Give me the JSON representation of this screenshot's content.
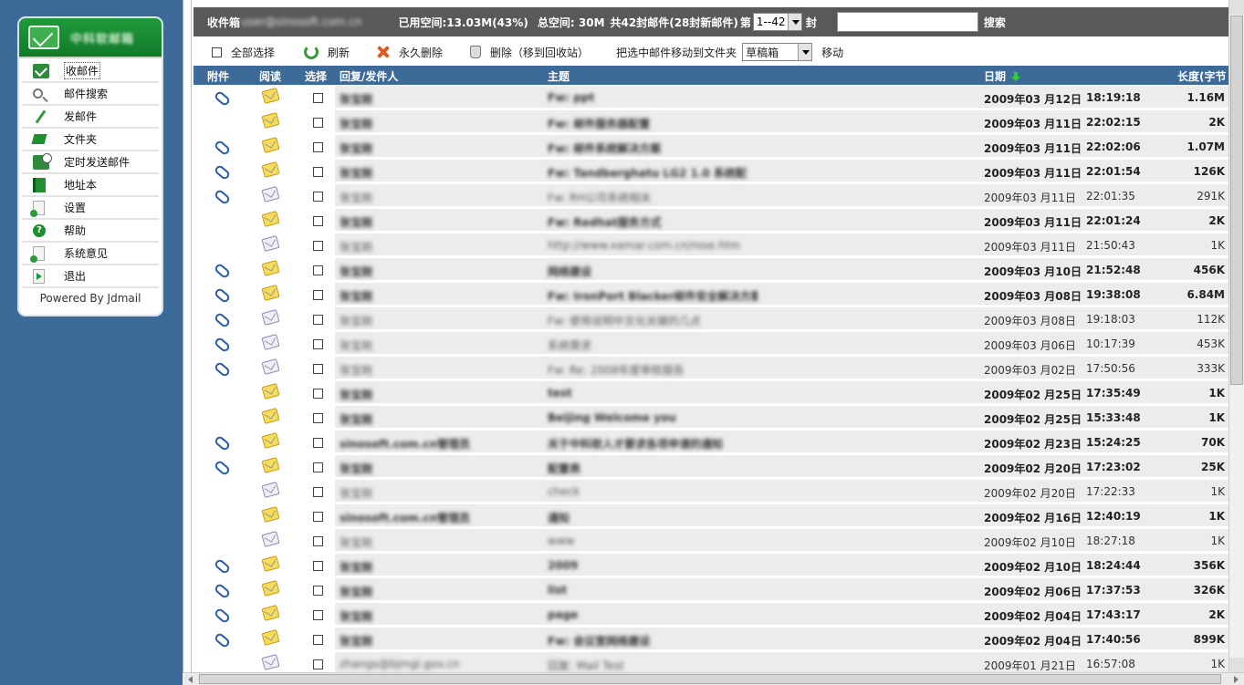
{
  "sidebar": {
    "logo_text": "中科软邮箱",
    "items": [
      {
        "label": "收邮件",
        "icon": "inbox-icon"
      },
      {
        "label": "邮件搜索",
        "icon": "search-icon"
      },
      {
        "label": "发邮件",
        "icon": "pen-icon"
      },
      {
        "label": "文件夹",
        "icon": "folder-icon"
      },
      {
        "label": "定时发送邮件",
        "icon": "timer-mail-icon"
      },
      {
        "label": "地址本",
        "icon": "address-book-icon"
      },
      {
        "label": "设置",
        "icon": "settings-doc-icon"
      },
      {
        "label": "帮助",
        "icon": "help-icon"
      },
      {
        "label": "系统意见",
        "icon": "feedback-doc-icon"
      },
      {
        "label": "退出",
        "icon": "exit-icon"
      }
    ],
    "powered": "Powered By Jdmail"
  },
  "topbar": {
    "inbox_label": "收件箱",
    "account": "user@sinosoft.com.cn",
    "used_space": "已用空间:13.03M(43%)",
    "total_space": "总空间: 30M",
    "count": "共42封邮件(28封新邮件)",
    "page_label": "第",
    "page_value": "1--42",
    "page_unit": "封",
    "search_placeholder": "",
    "search_label": "搜索"
  },
  "toolbar": {
    "select_all": "全部选择",
    "refresh": "刷新",
    "delete_forever": "永久删除",
    "delete_trash": "删除（移到回收站）",
    "move_label": "把选中邮件移动到文件夹",
    "folder_value": "草稿箱",
    "move_btn": "移动"
  },
  "columns": {
    "attachment": "附件",
    "read": "阅读",
    "select": "选择",
    "sender": "回复/发件人",
    "subject": "主题",
    "date": "日期",
    "size": "长度(字节"
  },
  "emails": [
    {
      "att": true,
      "unread": true,
      "sender": "张宝刚",
      "subject": "Fw: ppt",
      "date": "2009年03 月12日",
      "time": "18:19:18",
      "size": "1.16M"
    },
    {
      "att": false,
      "unread": true,
      "sender": "张宝刚",
      "subject": "Fw: 邮件服务器配置",
      "date": "2009年03 月11日",
      "time": "22:02:15",
      "size": "2K"
    },
    {
      "att": true,
      "unread": true,
      "sender": "张宝刚",
      "subject": "Fw: 邮件系统解决方案",
      "date": "2009年03 月11日",
      "time": "22:02:06",
      "size": "1.07M"
    },
    {
      "att": true,
      "unread": true,
      "sender": "张宝刚",
      "subject": "Fw: Tandberghatu LG2 1.0 系统配",
      "date": "2009年03 月11日",
      "time": "22:01:54",
      "size": "126K"
    },
    {
      "att": true,
      "unread": false,
      "sender": "张宝刚",
      "subject": "Fw: RH公司系统相关",
      "date": "2009年03 月11日",
      "time": "22:01:35",
      "size": "291K"
    },
    {
      "att": false,
      "unread": true,
      "sender": "张宝刚",
      "subject": "Fw: Redhat服务方式",
      "date": "2009年03 月11日",
      "time": "22:01:24",
      "size": "2K"
    },
    {
      "att": false,
      "unread": false,
      "sender": "张宝刚",
      "subject": "http://www.xamar.com.cn/rose.htm",
      "date": "2009年03 月11日",
      "time": "21:50:43",
      "size": "1K"
    },
    {
      "att": true,
      "unread": true,
      "sender": "张宝刚",
      "subject": "网络建设",
      "date": "2009年03 月10日",
      "time": "21:52:48",
      "size": "456K"
    },
    {
      "att": true,
      "unread": true,
      "sender": "张宝刚",
      "subject": "Fw: IronPort Blacker邮件安全解决方案",
      "date": "2009年03 月08日",
      "time": "19:38:08",
      "size": "6.84M"
    },
    {
      "att": true,
      "unread": false,
      "sender": "张宝刚",
      "subject": "Fw: 使用说明中文化关键的几点",
      "date": "2009年03 月08日",
      "time": "19:18:03",
      "size": "112K"
    },
    {
      "att": true,
      "unread": false,
      "sender": "张宝刚",
      "subject": "系统需求",
      "date": "2009年03 月06日",
      "time": "10:17:39",
      "size": "453K"
    },
    {
      "att": true,
      "unread": false,
      "sender": "张宝刚",
      "subject": "Fw: Re: 2008年度审核报告",
      "date": "2009年03 月02日",
      "time": "17:50:56",
      "size": "333K"
    },
    {
      "att": false,
      "unread": true,
      "sender": "张宝刚",
      "subject": "test",
      "date": "2009年02 月25日",
      "time": "17:35:49",
      "size": "1K"
    },
    {
      "att": false,
      "unread": true,
      "sender": "张宝刚",
      "subject": "Beijing Welcome you",
      "date": "2009年02 月25日",
      "time": "15:33:48",
      "size": "1K"
    },
    {
      "att": true,
      "unread": true,
      "sender": "sinosoft.com.cn管理员",
      "subject": "关于中科软人才要求各项申请的通知",
      "date": "2009年02 月23日",
      "time": "15:24:25",
      "size": "70K"
    },
    {
      "att": true,
      "unread": true,
      "sender": "张宝刚",
      "subject": "配置表",
      "date": "2009年02 月20日",
      "time": "17:23:02",
      "size": "25K"
    },
    {
      "att": false,
      "unread": false,
      "sender": "张宝刚",
      "subject": "check",
      "date": "2009年02 月20日",
      "time": "17:22:33",
      "size": "1K"
    },
    {
      "att": false,
      "unread": true,
      "sender": "sinosoft.com.cn管理员",
      "subject": "通知",
      "date": "2009年02 月16日",
      "time": "12:40:19",
      "size": "1K"
    },
    {
      "att": false,
      "unread": false,
      "sender": "张宝刚",
      "subject": "www",
      "date": "2009年02 月10日",
      "time": "18:27:18",
      "size": "1K"
    },
    {
      "att": true,
      "unread": true,
      "sender": "张宝刚",
      "subject": "2009",
      "date": "2009年02 月10日",
      "time": "18:24:44",
      "size": "356K"
    },
    {
      "att": true,
      "unread": true,
      "sender": "张宝刚",
      "subject": "list",
      "date": "2009年02 月06日",
      "time": "17:37:53",
      "size": "326K"
    },
    {
      "att": true,
      "unread": true,
      "sender": "张宝刚",
      "subject": "page",
      "date": "2009年02 月04日",
      "time": "17:43:17",
      "size": "2K"
    },
    {
      "att": true,
      "unread": true,
      "sender": "张宝刚",
      "subject": "Fw: 会议室网络建设",
      "date": "2009年02 月04日",
      "time": "17:40:56",
      "size": "899K"
    },
    {
      "att": false,
      "unread": false,
      "sender": "zhangs@bjmgl.gov.cn",
      "subject": "回复: Mail Test",
      "date": "2009年01 月21日",
      "time": "16:57:08",
      "size": "1K"
    }
  ]
}
